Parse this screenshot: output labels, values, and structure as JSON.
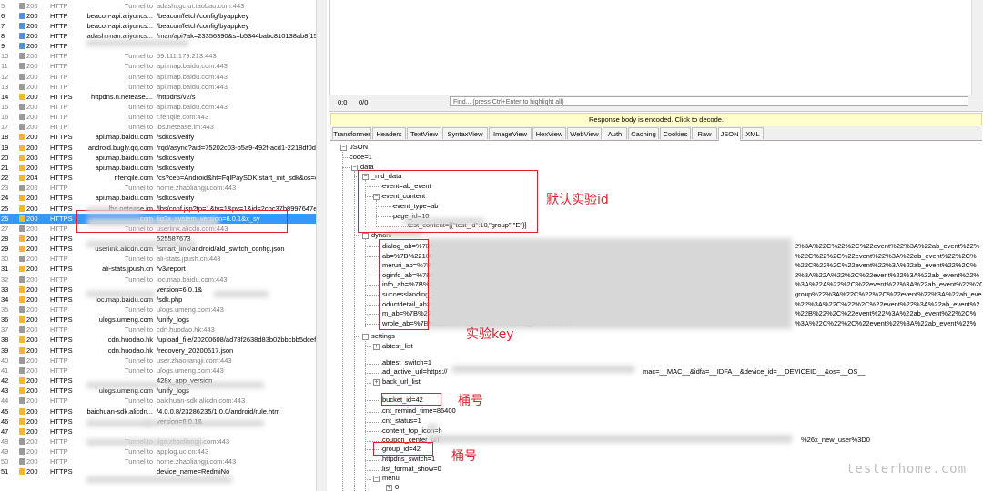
{
  "sessions": [
    {
      "num": "5",
      "result": "200",
      "protocol": "HTTP",
      "host": "Tunnel to",
      "url": "adashxgc.ut.taobao.com:443",
      "tunnel": true
    },
    {
      "num": "6",
      "result": "200",
      "protocol": "HTTP",
      "host": "beacon-api.aliyuncs...",
      "url": "/beacon/fetch/config/byappkey"
    },
    {
      "num": "7",
      "result": "200",
      "protocol": "HTTP",
      "host": "beacon-api.aliyuncs...",
      "url": "/beacon/fetch/config/byappkey"
    },
    {
      "num": "8",
      "result": "200",
      "protocol": "HTTP",
      "host": "adash.man.aliyuncs...",
      "url": "/man/api?ak=23356390&s=b5344babc810138ab8f15C"
    },
    {
      "num": "9",
      "result": "200",
      "protocol": "HTTP",
      "host": "",
      "url": ""
    },
    {
      "num": "10",
      "result": "200",
      "protocol": "HTTP",
      "host": "Tunnel to",
      "url": "59.111.179.213:443",
      "tunnel": true
    },
    {
      "num": "11",
      "result": "200",
      "protocol": "HTTP",
      "host": "Tunnel to",
      "url": "api.map.baidu.com:443",
      "tunnel": true
    },
    {
      "num": "12",
      "result": "200",
      "protocol": "HTTP",
      "host": "Tunnel to",
      "url": "api.map.baidu.com:443",
      "tunnel": true
    },
    {
      "num": "13",
      "result": "200",
      "protocol": "HTTP",
      "host": "Tunnel to",
      "url": "api.map.baidu.com:443",
      "tunnel": true
    },
    {
      "num": "14",
      "result": "200",
      "protocol": "HTTPS",
      "host": "httpdns.n.netease....",
      "url": "/httpdns/v2/s"
    },
    {
      "num": "15",
      "result": "200",
      "protocol": "HTTP",
      "host": "Tunnel to",
      "url": "api.map.baidu.com:443",
      "tunnel": true
    },
    {
      "num": "16",
      "result": "200",
      "protocol": "HTTP",
      "host": "Tunnel to",
      "url": "r.fenqile.com:443",
      "tunnel": true
    },
    {
      "num": "17",
      "result": "200",
      "protocol": "HTTP",
      "host": "Tunnel to",
      "url": "lbs.netease.im:443",
      "tunnel": true
    },
    {
      "num": "18",
      "result": "200",
      "protocol": "HTTPS",
      "host": "api.map.baidu.com",
      "url": "/sdkcs/verify"
    },
    {
      "num": "19",
      "result": "200",
      "protocol": "HTTPS",
      "host": "android.bugly.qq.com",
      "url": "/rqd/async?aid=75202c03-b5a9-492f-acd1-2218df0d5"
    },
    {
      "num": "20",
      "result": "200",
      "protocol": "HTTPS",
      "host": "api.map.baidu.com",
      "url": "/sdkcs/verify"
    },
    {
      "num": "21",
      "result": "200",
      "protocol": "HTTPS",
      "host": "api.map.baidu.com",
      "url": "/sdkcs/verify"
    },
    {
      "num": "22",
      "result": "204",
      "protocol": "HTTPS",
      "host": "r.fenqile.com",
      "url": "/cs?cep=Android&ht=FqlPaySDK.start_init_sdk&os=cl"
    },
    {
      "num": "23",
      "result": "200",
      "protocol": "HTTP",
      "host": "Tunnel to",
      "url": "home.zhaoliangji.com:443",
      "tunnel": true
    },
    {
      "num": "24",
      "result": "200",
      "protocol": "HTTPS",
      "host": "api.map.baidu.com",
      "url": "/sdkcs/verify"
    },
    {
      "num": "25",
      "result": "200",
      "protocol": "HTTPS",
      "host": "lbs.netease.im",
      "url": "/lbs/conf.jsp?tp=1&tv=1&pv=1&id=2cbc37b8997647e"
    },
    {
      "num": "26",
      "result": "200",
      "protocol": "HTTPS",
      "host": ".com",
      "url": "fig?x_system_version=6.0.1&x_sy",
      "selected": true
    },
    {
      "num": "27",
      "result": "200",
      "protocol": "HTTP",
      "host": "Tunnel to",
      "url": "userlink.alicdn.com:443",
      "tunnel": true
    },
    {
      "num": "28",
      "result": "200",
      "protocol": "HTTPS",
      "host": "",
      "url": "525587673"
    },
    {
      "num": "29",
      "result": "200",
      "protocol": "HTTPS",
      "host": "userlink.alicdn.com",
      "url": "/smart_link/android/ald_switch_config.json"
    },
    {
      "num": "30",
      "result": "200",
      "protocol": "HTTP",
      "host": "Tunnel to",
      "url": "ali-stats.jpush.cn:443",
      "tunnel": true
    },
    {
      "num": "31",
      "result": "200",
      "protocol": "HTTPS",
      "host": "ali-stats.jpush.cn",
      "url": "/v3/report"
    },
    {
      "num": "32",
      "result": "200",
      "protocol": "HTTP",
      "host": "Tunnel to",
      "url": "loc.map.baidu.com:443",
      "tunnel": true
    },
    {
      "num": "33",
      "result": "200",
      "protocol": "HTTPS",
      "host": "",
      "url": "version=6.0.1&"
    },
    {
      "num": "34",
      "result": "200",
      "protocol": "HTTPS",
      "host": "loc.map.baidu.com",
      "url": "/sdk.php"
    },
    {
      "num": "35",
      "result": "200",
      "protocol": "HTTP",
      "host": "Tunnel to",
      "url": "ulogs.umeng.com:443",
      "tunnel": true
    },
    {
      "num": "36",
      "result": "200",
      "protocol": "HTTPS",
      "host": "ulogs.umeng.com",
      "url": "/unify_logs"
    },
    {
      "num": "37",
      "result": "200",
      "protocol": "HTTP",
      "host": "Tunnel to",
      "url": "cdn.huodao.hk:443",
      "tunnel": true
    },
    {
      "num": "38",
      "result": "200",
      "protocol": "HTTPS",
      "host": "cdn.huodao.hk",
      "url": "/upload_file/20200608/ad78f2638d83b02bbcbb5dcef8"
    },
    {
      "num": "39",
      "result": "200",
      "protocol": "HTTPS",
      "host": "cdn.huodao.hk",
      "url": "/recovery_20200617.json"
    },
    {
      "num": "40",
      "result": "200",
      "protocol": "HTTP",
      "host": "Tunnel to",
      "url": "user.zhaoliangji.com:443",
      "tunnel": true
    },
    {
      "num": "41",
      "result": "200",
      "protocol": "HTTP",
      "host": "Tunnel to",
      "url": "ulogs.umeng.com:443",
      "tunnel": true
    },
    {
      "num": "42",
      "result": "200",
      "protocol": "HTTPS",
      "host": "",
      "url": "428x_app_version"
    },
    {
      "num": "43",
      "result": "200",
      "protocol": "HTTPS",
      "host": "ulogs.umeng.com",
      "url": "/unify_logs"
    },
    {
      "num": "44",
      "result": "200",
      "protocol": "HTTP",
      "host": "Tunnel to",
      "url": "baichuan-sdk.alicdn.com:443",
      "tunnel": true
    },
    {
      "num": "45",
      "result": "200",
      "protocol": "HTTPS",
      "host": "baichuan-sdk.alicdn...",
      "url": "/4.0.0.8/23286235/1.0.0/android/rule.htm"
    },
    {
      "num": "46",
      "result": "200",
      "protocol": "HTTPS",
      "host": "",
      "url": "version=6.0.1&"
    },
    {
      "num": "47",
      "result": "200",
      "protocol": "HTTPS",
      "host": "",
      "url": ""
    },
    {
      "num": "48",
      "result": "200",
      "protocol": "HTTP",
      "host": "Tunnel to",
      "url": "jiga.zhaoliangji.com:443",
      "tunnel": true
    },
    {
      "num": "49",
      "result": "200",
      "protocol": "HTTP",
      "host": "Tunnel to",
      "url": "applog.uc.cn:443",
      "tunnel": true
    },
    {
      "num": "50",
      "result": "200",
      "protocol": "HTTP",
      "host": "Tunnel to",
      "url": "home.zhaoliangji.com:443",
      "tunnel": true
    },
    {
      "num": "51",
      "result": "200",
      "protocol": "HTTPS",
      "host": "",
      "url": "device_name=RedmiNo"
    }
  ],
  "status_bar": {
    "left": "0:0",
    "right": "0/0"
  },
  "find": {
    "placeholder": "Find... (press Ctrl+Enter to highlight all)"
  },
  "notice": "Response body is encoded. Click to decode.",
  "tabs": [
    "Transformer",
    "Headers",
    "TextView",
    "SyntaxView",
    "ImageView",
    "HexView",
    "WebView",
    "Auth",
    "Caching",
    "Cookies",
    "Raw",
    "JSON",
    "XML"
  ],
  "active_tab": "JSON",
  "tree": {
    "root": "JSON",
    "code": "code=1",
    "data": "data",
    "md_data": "_md_data",
    "event_ab": "event=ab_event",
    "event_content": "event_content",
    "event_type": "event_type=ab",
    "page_id": "page_id=10",
    "test_content": "test_content=[{\"test_id\":10",
    "test_content_tail": ",\"group\":\"E\"}]",
    "dynamic": "dynam",
    "dyn_rows": [
      {
        "left": "dialog_ab=%7B%2210040%22%3A%7B%22test_id%22%3A",
        "right": "2%3A%22C%22%2C%22event%22%3A%22ab_event%22%"
      },
      {
        "left": "ab=%7B%2210035%22%3A%7B%22test_id%22%3A10035%",
        "right": "%22C%22%2C%22event%22%3A%22ab_event%22%2C%"
      },
      {
        "left": "meruri_ab=%7B%2210047%22%3A%7B%22test_id%22%3A",
        "right": "%22C%22%2C%22event%22%3A%22ab_event%22%2C%"
      },
      {
        "left": "oginfo_ab=%7B%2210040%22%3A%7B%22test_id%22%3A",
        "right": "2%3A%22A%22%2C%22event%22%3A%22ab_event%22%"
      },
      {
        "left": "info_ab=%7B%2210032%22%3A%7B%22test_id%22%3A10",
        "right": "%3A%22A%22%2C%22event%22%3A%22ab_event%22%2C"
      },
      {
        "left": "successlanding_ab=%7B%2210040%22%3A%7B%22test_id%",
        "right": "group%22%3A%22C%22%2C%22event%22%3A%22ab_even"
      },
      {
        "left": "oductdetail_ab=%7B%2210040%22%3A%7B%22test_id%22%",
        "right": "%22%3A%22C%22%2C%22event%22%3A%22ab_event%2"
      },
      {
        "left": "m_ab=%7B%2210059%22%3A%7B%22test_id%22%3A10",
        "right": "%22B%22%2C%22event%22%3A%22ab_event%22%2C%"
      },
      {
        "left": "wrole_ab=%7B%2210040%22%3A%7B%22test_id%22%3A10",
        "right": "%3A%22C%22%2C%22event%22%3A%22ab_event%22%"
      }
    ],
    "settings": "settings",
    "abtest_list": "abtest_list",
    "abtest_switch": "abtest_switch=1",
    "ad_active_url": "ad_active_url=https://",
    "ad_active_url_tail": "mac=__MAC__&idfa=__IDFA__&device_id=__DEVICEID__&os=__OS__",
    "back_url_list": "back_url_list",
    "bucket_id": "bucket_id=42",
    "cnt_remind_time": "cnt_remind_time=86400",
    "cnt_status": "cnt_status=1",
    "content_top_icon": "content_top_icon=h",
    "coupon_center_url": "coupon_center_url",
    "coupon_tail": "%26x_new_user%3D0",
    "group_id": "group_id=42",
    "httpdns_switch": "httpdns_switch=1",
    "list_format_show": "list_format_show=0",
    "menu": "menu",
    "menu_0": "0"
  },
  "annotations": {
    "default_id": "默认实验id",
    "exp_key": "实验key",
    "bucket1": "桶号",
    "bucket2": "桶号"
  },
  "watermark": "testerhome.com",
  "colors": {
    "selection": "#3399ff",
    "annotation": "#e0202f",
    "notice_bg": "#ffffcc"
  }
}
